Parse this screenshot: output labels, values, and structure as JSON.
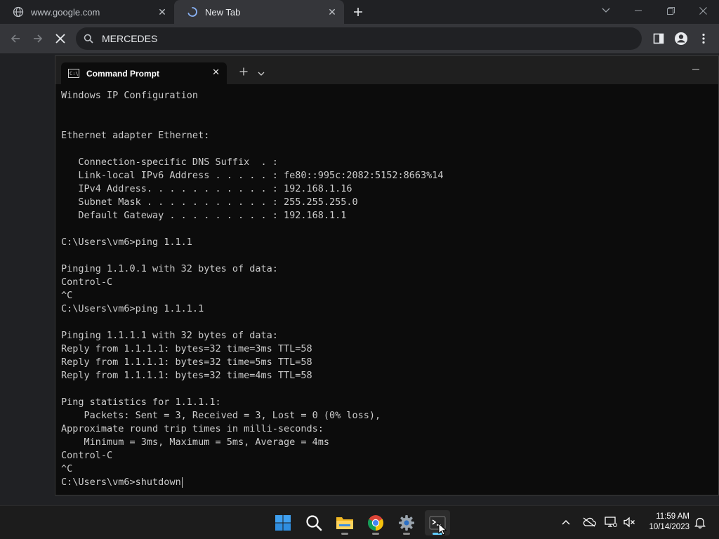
{
  "browser": {
    "tabs": [
      {
        "label": "www.google.com",
        "icon": "globe-icon",
        "active": false
      },
      {
        "label": "New Tab",
        "icon": "loading-spinner-icon",
        "active": true
      }
    ],
    "omnibox": {
      "value": "MERCEDES",
      "placeholder": ""
    }
  },
  "terminal": {
    "tab_title": "Command Prompt",
    "lines": [
      "Windows IP Configuration",
      "",
      "",
      "Ethernet adapter Ethernet:",
      "",
      "   Connection-specific DNS Suffix  . :",
      "   Link-local IPv6 Address . . . . . : fe80::995c:2082:5152:8663%14",
      "   IPv4 Address. . . . . . . . . . . : 192.168.1.16",
      "   Subnet Mask . . . . . . . . . . . : 255.255.255.0",
      "   Default Gateway . . . . . . . . . : 192.168.1.1",
      "",
      "C:\\Users\\vm6>ping 1.1.1",
      "",
      "Pinging 1.1.0.1 with 32 bytes of data:",
      "Control-C",
      "^C",
      "C:\\Users\\vm6>ping 1.1.1.1",
      "",
      "Pinging 1.1.1.1 with 32 bytes of data:",
      "Reply from 1.1.1.1: bytes=32 time=3ms TTL=58",
      "Reply from 1.1.1.1: bytes=32 time=5ms TTL=58",
      "Reply from 1.1.1.1: bytes=32 time=4ms TTL=58",
      "",
      "Ping statistics for 1.1.1.1:",
      "    Packets: Sent = 3, Received = 3, Lost = 0 (0% loss),",
      "Approximate round trip times in milli-seconds:",
      "    Minimum = 3ms, Maximum = 5ms, Average = 4ms",
      "Control-C",
      "^C"
    ],
    "prompt": "C:\\Users\\vm6>",
    "current_input": "shutdown"
  },
  "taskbar": {
    "apps": [
      "start-icon",
      "search-icon",
      "file-explorer-icon",
      "chrome-icon",
      "settings-icon",
      "terminal-icon"
    ],
    "clock": {
      "time": "11:59 AM",
      "date": "10/14/2023"
    }
  },
  "colors": {
    "terminal_bg": "#0c0c0c",
    "terminal_text": "#cccccc",
    "browser_bg": "#202124",
    "toolbar_bg": "#35363a",
    "accent": "#60cdff"
  }
}
